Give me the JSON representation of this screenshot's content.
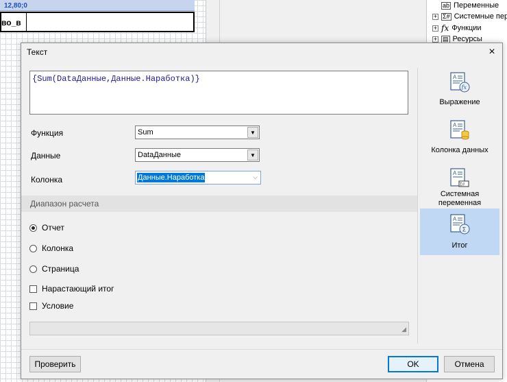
{
  "background": {
    "coord": "12,80;0",
    "cell_text": "во_в",
    "tree_items": [
      {
        "icon": "var-icon",
        "label": "Переменные"
      },
      {
        "icon": "sysvar-icon",
        "label": "Системные пер"
      },
      {
        "icon": "fx-icon",
        "label": "Функции"
      },
      {
        "icon": "resources-icon",
        "label": "Ресурсы"
      }
    ]
  },
  "dialog": {
    "title": "Текст",
    "close": "×",
    "expression": "{Sum(DataДанные,Данные.Наработка)}",
    "fields": {
      "function_label": "Функция",
      "function_value": "Sum",
      "data_label": "Данные",
      "data_value": "DataДанные",
      "column_label": "Колонка",
      "column_value": "Данные.Наработка"
    },
    "range": {
      "header": "Диапазон расчета",
      "options": [
        {
          "label": "Отчет",
          "selected": true
        },
        {
          "label": "Колонка",
          "selected": false
        },
        {
          "label": "Страница",
          "selected": false
        }
      ]
    },
    "checks": {
      "running_total": "Нарастающий итог",
      "running_total_checked": false,
      "condition": "Условие",
      "condition_checked": false
    },
    "sidebar": {
      "expression": "Выражение",
      "data_column": "Колонка данных",
      "system_var_1": "Системная",
      "system_var_2": "переменная",
      "total": "Итог",
      "active": "total",
      "active_color": "#c0d8f4"
    },
    "buttons": {
      "check": "Проверить",
      "ok": "OK",
      "cancel": "Отмена"
    }
  }
}
